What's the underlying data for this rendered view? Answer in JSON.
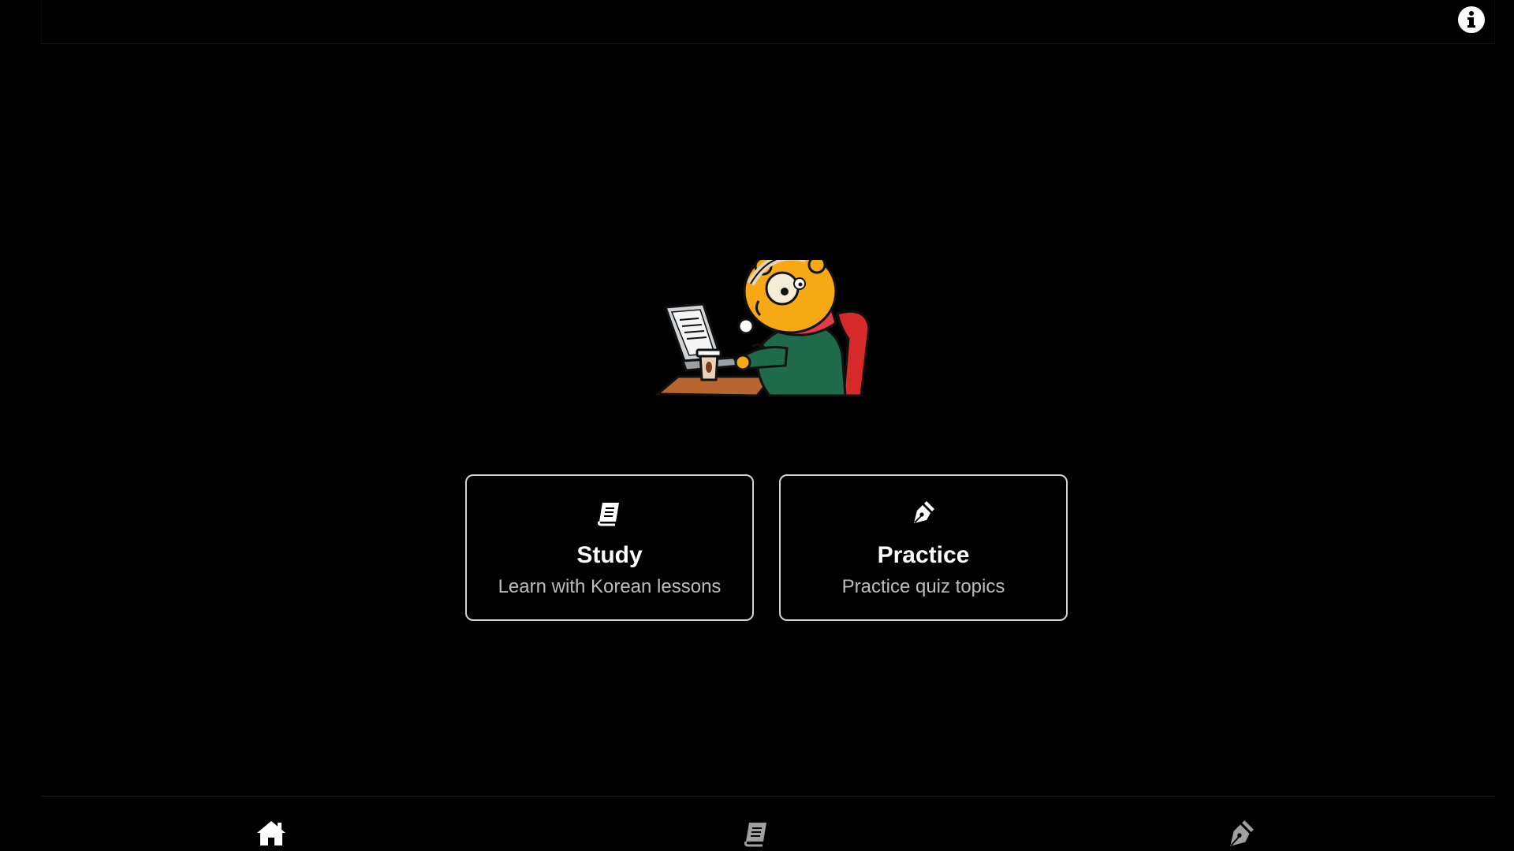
{
  "header": {
    "info_icon": "info-icon"
  },
  "hero": {
    "illustration": "mascot-at-laptop-illustration"
  },
  "cards": [
    {
      "id": "study",
      "icon": "book-icon",
      "title": "Study",
      "subtitle": "Learn with Korean lessons"
    },
    {
      "id": "practice",
      "icon": "pen-nib-icon",
      "title": "Practice",
      "subtitle": "Practice quiz topics"
    }
  ],
  "bottom_nav": {
    "items": [
      {
        "id": "home",
        "icon": "home-icon",
        "active": true
      },
      {
        "id": "study",
        "icon": "book-icon",
        "active": false
      },
      {
        "id": "practice",
        "icon": "pen-nib-icon",
        "active": false
      }
    ],
    "active_color": "#ffffff",
    "inactive_color": "#a0a0a0"
  },
  "colors": {
    "background": "#000000",
    "card_border": "#d4d4d4",
    "subtitle_text": "#bdbdbd"
  }
}
